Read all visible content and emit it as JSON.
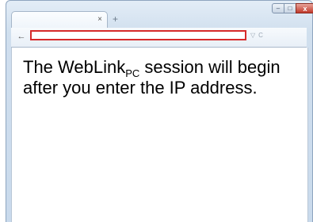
{
  "tab": {
    "close_glyph": "×"
  },
  "toolbar": {
    "new_tab_glyph": "+",
    "back_glyph": "←",
    "url_value": "",
    "dropdown_glyph": "▽",
    "refresh_glyph": "C"
  },
  "window_controls": {
    "minimize": "–",
    "maximize": "□",
    "close": "x"
  },
  "page": {
    "line1_prefix": "The WebLink",
    "line1_subscript": "PC",
    "line1_suffix": " session will begin",
    "line2": "after you enter the IP address."
  },
  "colors": {
    "url_border": "#d62a2a",
    "frame": "#d0dfee",
    "close_button": "#c1392b"
  }
}
